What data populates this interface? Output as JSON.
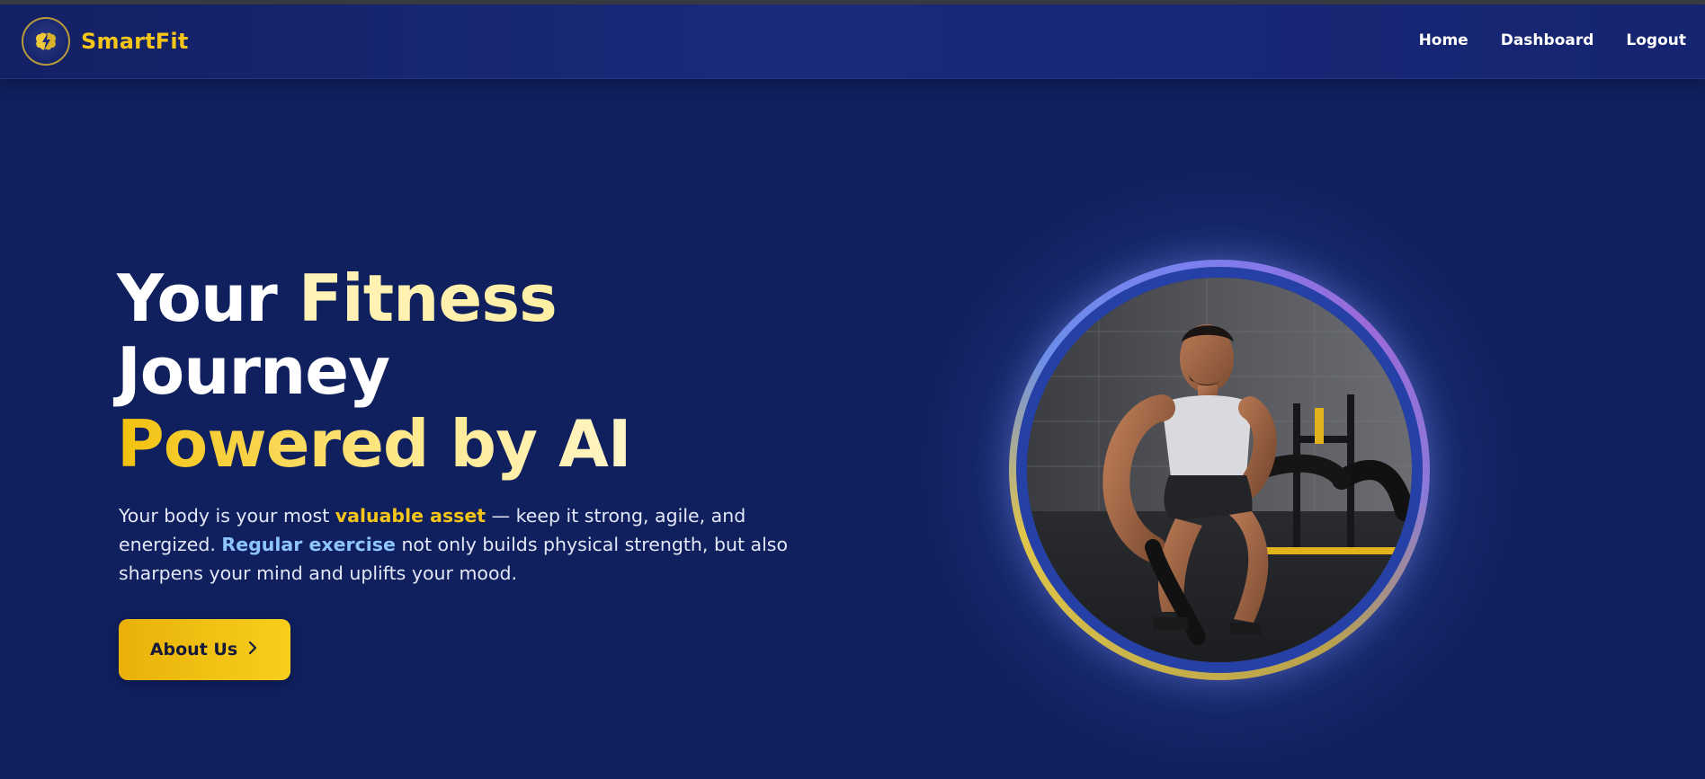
{
  "brand": {
    "name": "SmartFit",
    "logo_icon": "brain-bolt-icon",
    "accent_color": "#f5c518"
  },
  "nav": {
    "items": [
      "Home",
      "Dashboard",
      "Logout"
    ]
  },
  "hero": {
    "title_line1_part1": "Your ",
    "title_line1_part2": "Fitness",
    "title_line2": "Journey",
    "title_line3": "Powered by AI",
    "description": {
      "part1": "Your body is your most ",
      "highlight1": "valuable asset",
      "part2": " — keep it strong, agile, and energized. ",
      "highlight2": "Regular exercise",
      "part3": " not only builds physical strength, but also sharpens your mind and uplifts your mood."
    },
    "cta_label": "About Us",
    "cta_icon": "chevron-right-icon",
    "image_subject": "man-battle-ropes-gym-photo"
  },
  "colors": {
    "background": "#101f5e",
    "gold": "#f5c518",
    "light_blue": "#8ec5ff"
  }
}
